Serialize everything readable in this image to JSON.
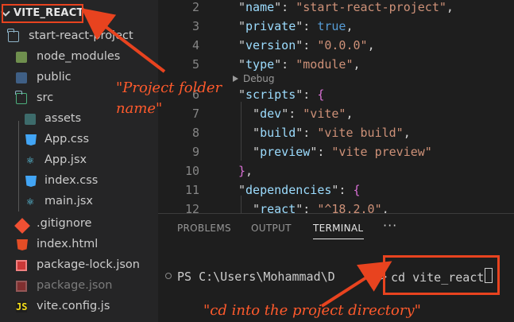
{
  "explorer": {
    "root_label": "VITE_REACT",
    "items": [
      {
        "label": "start-react-project",
        "icon": "folder-open-icon"
      },
      {
        "label": "node_modules",
        "icon": "node-folder-icon"
      },
      {
        "label": "public",
        "icon": "folder-icon"
      },
      {
        "label": "src",
        "icon": "src-folder-icon"
      },
      {
        "label": "assets",
        "icon": "assets-folder-icon"
      },
      {
        "label": "App.css",
        "icon": "css-file-icon"
      },
      {
        "label": "App.jsx",
        "icon": "react-file-icon"
      },
      {
        "label": "index.css",
        "icon": "css-file-icon"
      },
      {
        "label": "main.jsx",
        "icon": "react-file-icon"
      },
      {
        "label": ".gitignore",
        "icon": "git-file-icon"
      },
      {
        "label": "index.html",
        "icon": "html-file-icon"
      },
      {
        "label": "package-lock.json",
        "icon": "npm-file-icon"
      },
      {
        "label": "package.json",
        "icon": "npm-file-icon"
      },
      {
        "label": "vite.config.js",
        "icon": "js-file-icon"
      }
    ]
  },
  "editor": {
    "codelens": "Debug",
    "lines": [
      {
        "n": "2",
        "parts": [
          [
            "pun",
            "\""
          ],
          [
            "key",
            "name"
          ],
          [
            "pun",
            "\": "
          ],
          [
            "str",
            "\"start-react-project\""
          ],
          [
            "pun",
            ","
          ]
        ]
      },
      {
        "n": "3",
        "parts": [
          [
            "pun",
            "\""
          ],
          [
            "key",
            "private"
          ],
          [
            "pun",
            "\": "
          ],
          [
            "kw",
            "true"
          ],
          [
            "pun",
            ","
          ]
        ]
      },
      {
        "n": "4",
        "parts": [
          [
            "pun",
            "\""
          ],
          [
            "key",
            "version"
          ],
          [
            "pun",
            "\": "
          ],
          [
            "str",
            "\"0.0.0\""
          ],
          [
            "pun",
            ","
          ]
        ]
      },
      {
        "n": "5",
        "parts": [
          [
            "pun",
            "\""
          ],
          [
            "key",
            "type"
          ],
          [
            "pun",
            "\": "
          ],
          [
            "str",
            "\"module\""
          ],
          [
            "pun",
            ","
          ]
        ]
      },
      {
        "n": "6",
        "parts": [
          [
            "pun",
            "\""
          ],
          [
            "key",
            "scripts"
          ],
          [
            "pun",
            "\": "
          ],
          [
            "br",
            "{"
          ]
        ]
      },
      {
        "n": "7",
        "parts": [
          [
            "pun",
            "  \""
          ],
          [
            "key",
            "dev"
          ],
          [
            "pun",
            "\": "
          ],
          [
            "str",
            "\"vite\""
          ],
          [
            "pun",
            ","
          ]
        ]
      },
      {
        "n": "8",
        "parts": [
          [
            "pun",
            "  \""
          ],
          [
            "key",
            "build"
          ],
          [
            "pun",
            "\": "
          ],
          [
            "str",
            "\"vite build\""
          ],
          [
            "pun",
            ","
          ]
        ]
      },
      {
        "n": "9",
        "parts": [
          [
            "pun",
            "  \""
          ],
          [
            "key",
            "preview"
          ],
          [
            "pun",
            "\": "
          ],
          [
            "str",
            "\"vite preview\""
          ]
        ]
      },
      {
        "n": "10",
        "parts": [
          [
            "br",
            "}"
          ],
          [
            "pun",
            ","
          ]
        ]
      },
      {
        "n": "11",
        "parts": [
          [
            "pun",
            "\""
          ],
          [
            "key",
            "dependencies"
          ],
          [
            "pun",
            "\": "
          ],
          [
            "br",
            "{"
          ]
        ]
      },
      {
        "n": "12",
        "parts": [
          [
            "pun",
            "  \""
          ],
          [
            "key",
            "react"
          ],
          [
            "pun",
            "\": "
          ],
          [
            "str",
            "\"^18.2.0\""
          ],
          [
            "pun",
            ","
          ]
        ]
      }
    ]
  },
  "panel": {
    "tabs": [
      "PROBLEMS",
      "OUTPUT",
      "TERMINAL"
    ],
    "active_tab": "TERMINAL",
    "more_label": "···",
    "prompt": "PS C:\\Users\\Mohammad\\D",
    "prompt_tail": "p>",
    "command": "cd vite_react"
  },
  "annotations": {
    "folder_note": "\"Project folder\nname\"",
    "terminal_note": "\"cd into the project directory\"",
    "color": "#e8431f"
  }
}
